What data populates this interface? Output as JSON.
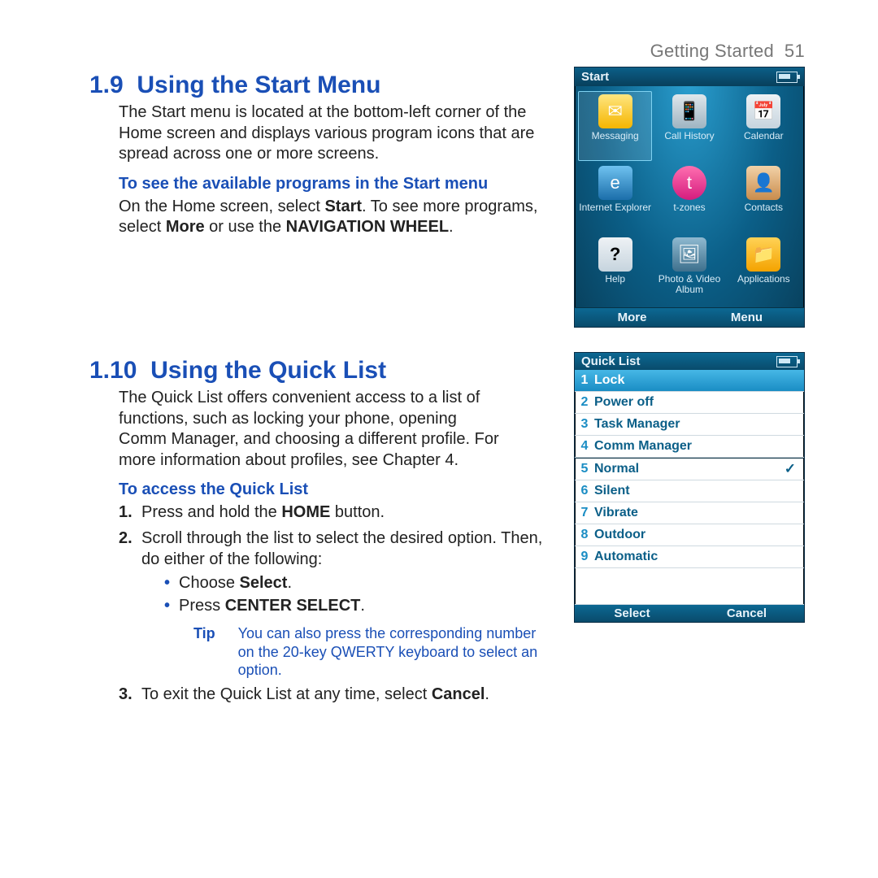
{
  "header": {
    "section": "Getting Started",
    "page": "51"
  },
  "sec19": {
    "number": "1.9",
    "title": "Using the Start Menu",
    "intro": "The Start menu is located at the bottom-left corner of the Home screen and displays various program icons that are spread across one or more screens.",
    "subhead": "To see the available programs in the Start menu",
    "body_pre": "On the Home screen, select ",
    "body_bold1": "Start",
    "body_mid": ". To see more programs, select ",
    "body_bold2": "More",
    "body_mid2": " or use the ",
    "body_bold3": "NAVIGATION WHEEL",
    "body_post": "."
  },
  "start_screen": {
    "title": "Start",
    "apps": [
      {
        "label": "Messaging",
        "icon": "envelope-icon",
        "glyph": "✉"
      },
      {
        "label": "Call History",
        "icon": "phone-icon",
        "glyph": "📱"
      },
      {
        "label": "Calendar",
        "icon": "calendar-icon",
        "glyph": "📅"
      },
      {
        "label": "Internet Explorer",
        "icon": "ie-icon",
        "glyph": "e"
      },
      {
        "label": "t-zones",
        "icon": "tzones-icon",
        "glyph": "t"
      },
      {
        "label": "Contacts",
        "icon": "contacts-icon",
        "glyph": "👤"
      },
      {
        "label": "Help",
        "icon": "help-icon",
        "glyph": "?"
      },
      {
        "label": "Photo & Video Album",
        "icon": "photo-video-icon",
        "glyph": "🖼"
      },
      {
        "label": "Applications",
        "icon": "applications-icon",
        "glyph": "📁"
      }
    ],
    "soft_left": "More",
    "soft_right": "Menu"
  },
  "sec110": {
    "number": "1.10",
    "title": "Using the Quick List",
    "intro": "The Quick List offers convenient access to a list of functions, such as locking your phone, opening Comm Manager, and choosing a different profile. For more information about profiles, see Chapter 4.",
    "subhead": "To access the Quick List",
    "step1_pre": "Press and hold the ",
    "step1_bold": "HOME",
    "step1_post": " button.",
    "step2": "Scroll through the list to select the desired option. Then, do either of the following:",
    "bullet1_pre": "Choose ",
    "bullet1_bold": "Select",
    "bullet1_post": ".",
    "bullet2_pre": "Press ",
    "bullet2_bold": "CENTER SELECT",
    "bullet2_post": ".",
    "tip_label": "Tip",
    "tip_text": "You can also press the corresponding number on the 20-key QWERTY keyboard to select an option.",
    "step3_pre": "To exit the Quick List at any time, select ",
    "step3_bold": "Cancel",
    "step3_post": "."
  },
  "quicklist_screen": {
    "title": "Quick List",
    "items": [
      {
        "n": "1",
        "label": "Lock",
        "selected": true
      },
      {
        "n": "2",
        "label": "Power off"
      },
      {
        "n": "3",
        "label": "Task Manager"
      },
      {
        "n": "4",
        "label": "Comm Manager"
      },
      {
        "n": "5",
        "label": "Normal",
        "checked": true
      },
      {
        "n": "6",
        "label": "Silent"
      },
      {
        "n": "7",
        "label": "Vibrate"
      },
      {
        "n": "8",
        "label": "Outdoor"
      },
      {
        "n": "9",
        "label": "Automatic"
      }
    ],
    "soft_left": "Select",
    "soft_right": "Cancel"
  }
}
